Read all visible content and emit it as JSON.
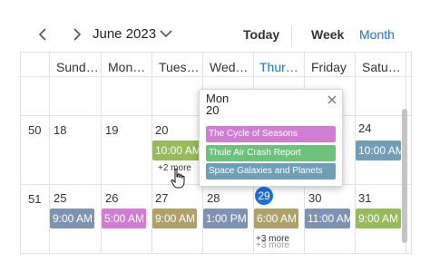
{
  "toolbar": {
    "period": "June 2023",
    "today_label": "Today",
    "week_label": "Week",
    "month_label": "Month",
    "prev_icon": "chevron-left-icon",
    "next_icon": "chevron-right-icon",
    "caret_icon": "chevron-down-icon"
  },
  "colors": {
    "accent": "#1d6fe0",
    "teal": "#6f9fb4",
    "green": "#95bb5a",
    "tan": "#b0a16b",
    "pink": "#d27dd5",
    "gray_blue": "#7e93b4",
    "popup_green": "#6dc27a"
  },
  "day_headers": [
    "Sund…",
    "Mon…",
    "Tues…",
    "Wed…",
    "Thur…",
    "Friday",
    "Satu…"
  ],
  "week_numbers": [
    "50",
    "51"
  ],
  "week1_dates": [
    "18",
    "19",
    "20",
    "21",
    "22",
    "23",
    "24"
  ],
  "week2_dates": [
    "25",
    "26",
    "27",
    "28",
    "29",
    "30",
    "31"
  ],
  "week1_events": {
    "tue": "10:00 AM",
    "sat": "10:00 AM",
    "tue_more": "+2 more"
  },
  "week2_events": {
    "sun": "9:00 AM",
    "mon": "5:00 AM",
    "tue": "9:00 AM",
    "wed": "1:00 PM",
    "thu": "6:00 AM",
    "fri": "11:00 AM",
    "sat": "9:00 AM",
    "thu_more": "+3 more",
    "thu_more_shadow": "+3 more"
  },
  "popup": {
    "day": "Mon",
    "date": "20",
    "events": [
      "The Cycle of Seasons",
      "Thule Air Crash Report",
      "Space Galaxies and Planets"
    ]
  }
}
